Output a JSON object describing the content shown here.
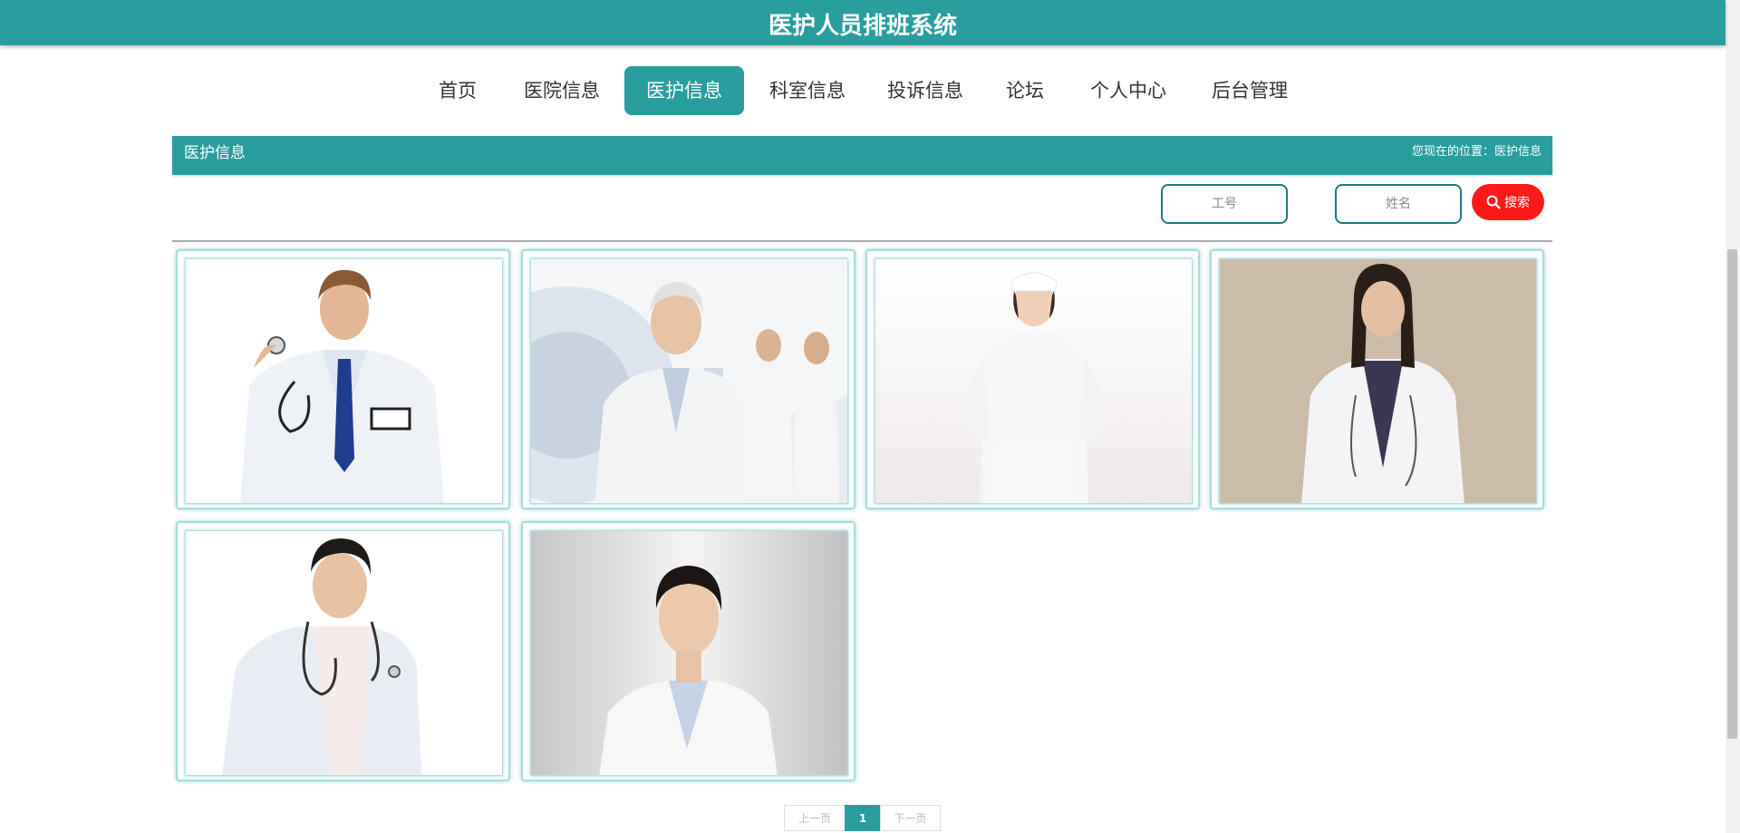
{
  "app_title": "医护人员排班系统",
  "nav": [
    {
      "label": "首页",
      "active": false
    },
    {
      "label": "医院信息",
      "active": false
    },
    {
      "label": "医护信息",
      "active": true
    },
    {
      "label": "科室信息",
      "active": false
    },
    {
      "label": "投诉信息",
      "active": false
    },
    {
      "label": "论坛",
      "active": false
    },
    {
      "label": "个人中心",
      "active": false
    },
    {
      "label": "后台管理",
      "active": false
    }
  ],
  "section": {
    "title": "医护信息",
    "location": "您现在的位置：医护信息"
  },
  "search": {
    "staff_no_placeholder": "工号",
    "name_placeholder": "姓名",
    "button_label": "搜索",
    "button_icon": "search-icon"
  },
  "cards": [
    {
      "photo": "male doctor with stethoscope and blue tie"
    },
    {
      "photo": "senior doctor in front of CT scanner"
    },
    {
      "photo": "nurse in white uniform and cap"
    },
    {
      "photo": "female doctor on beige background"
    },
    {
      "photo": "young male doctor with stethoscope"
    },
    {
      "photo": "male doctor portrait grey background"
    }
  ],
  "pagination": {
    "prev": "上一页",
    "current": "1",
    "next": "下一页"
  },
  "colors": {
    "primary": "#2a9d9e",
    "search_button": "#ff1a1a"
  }
}
